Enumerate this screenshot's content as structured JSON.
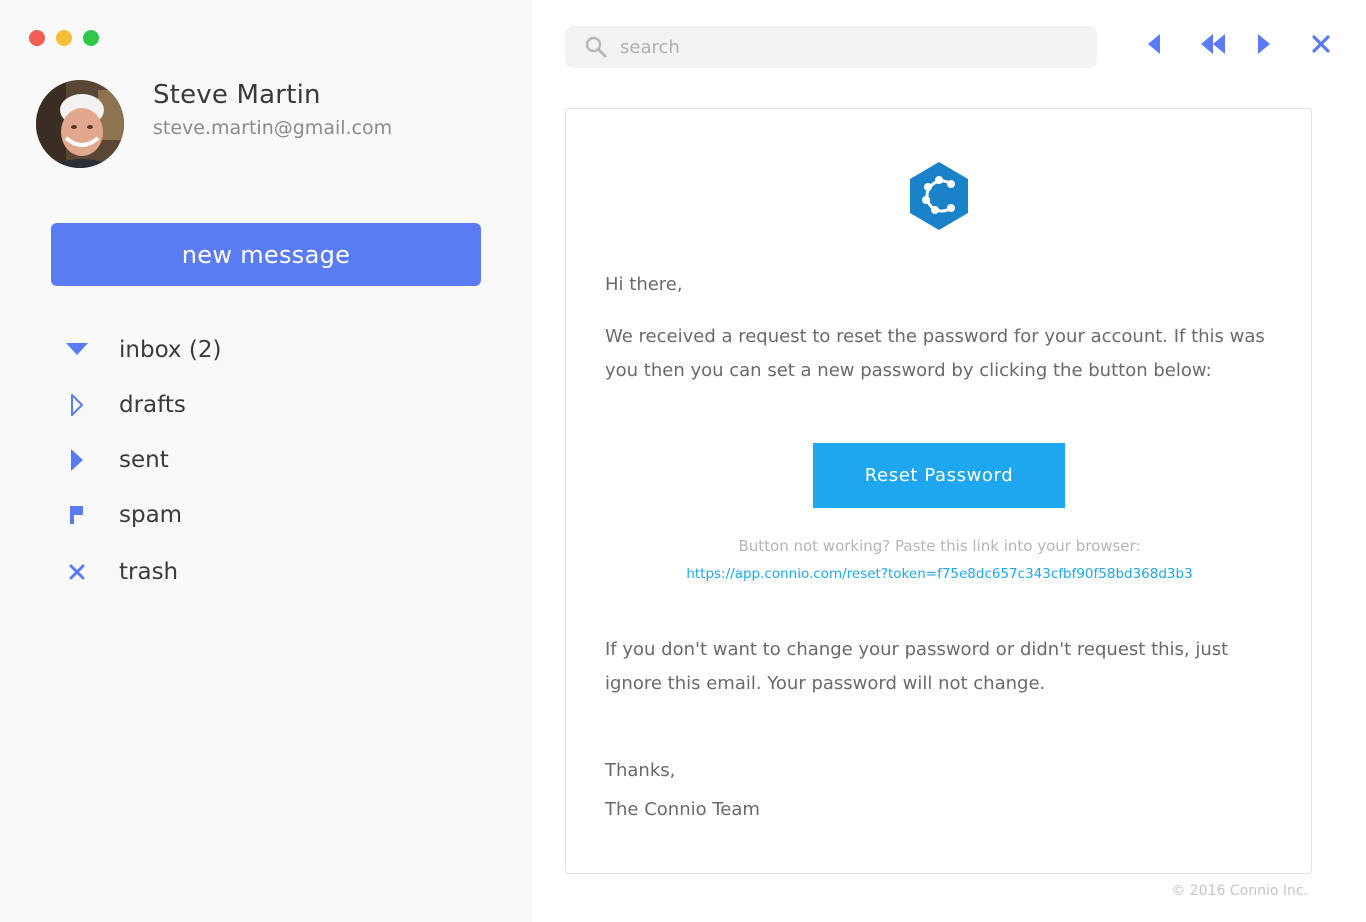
{
  "window": {
    "controls": [
      {
        "name": "close",
        "color": "#f15e58"
      },
      {
        "name": "minimize",
        "color": "#f6be35"
      },
      {
        "name": "maximize",
        "color": "#31c748"
      }
    ]
  },
  "user": {
    "name": "Steve Martin",
    "email": "steve.martin@gmail.com"
  },
  "sidebar": {
    "new_message_label": "new message",
    "items": [
      {
        "label": "inbox (2)",
        "icon": "caret-down-icon"
      },
      {
        "label": "drafts",
        "icon": "caret-right-outline-icon"
      },
      {
        "label": "sent",
        "icon": "caret-right-icon"
      },
      {
        "label": "spam",
        "icon": "flag-icon"
      },
      {
        "label": "trash",
        "icon": "close-icon"
      }
    ]
  },
  "search": {
    "placeholder": "search"
  },
  "toolbar": {
    "buttons": [
      "reply-icon",
      "reply-all-icon",
      "forward-icon",
      "close-icon"
    ]
  },
  "email": {
    "greeting": "Hi there,",
    "body1": "We received a request to reset the password for your account. If this was you then you can set a new password by clicking the button below:",
    "button_label": "Reset Password",
    "help_text": "Button not working? Paste this link into your browser:",
    "link": "https://app.connio.com/reset?token=f75e8dc657c343cfbf90f58bd368d3b3",
    "body2": "If you don't want to change your password or didn't request this, just ignore this email. Your password will not change.",
    "signoff": "Thanks,",
    "signature": "The Connio Team"
  },
  "footer": {
    "copyright": "© 2016 Connio Inc."
  },
  "colors": {
    "accent": "#5b7bf4",
    "button": "#1ea7ee",
    "logo": "#1a82c9"
  }
}
